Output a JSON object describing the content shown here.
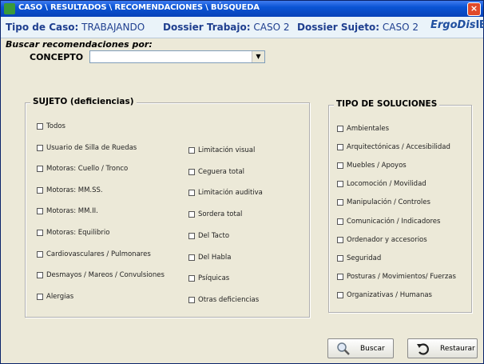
{
  "window": {
    "title": "CASO \\ RESULTADOS \\ RECOMENDACIONES \\ BÚSQUEDA",
    "close_label": "×"
  },
  "info": {
    "tipo_label": "Tipo de Caso:",
    "tipo_value": "TRABAJANDO",
    "dossier_trabajo_label": "Dossier Trabajo:",
    "dossier_trabajo_value": "CASO 2",
    "dossier_sujeto_label": "Dossier Sujeto:",
    "dossier_sujeto_value": "CASO 2",
    "logo_ergo": "ErgoDis",
    "logo_ibv": "IBV"
  },
  "search": {
    "heading": "Buscar recomendaciones por:",
    "concepto_label": "CONCEPTO",
    "concepto_value": ""
  },
  "sujeto": {
    "title": "SUJETO (deficiencias)",
    "col1": [
      "Todos",
      "Usuario de Silla de Ruedas",
      "Motoras: Cuello / Tronco",
      "Motoras: MM.SS.",
      "Motoras: MM.II.",
      "Motoras: Equilibrio",
      "Cardiovasculares / Pulmonares",
      "Desmayos / Mareos / Convulsiones",
      "Alergias"
    ],
    "col2": [
      "Limitación visual",
      "Ceguera total",
      "Limitación auditiva",
      "Sordera total",
      "Del Tacto",
      "Del Habla",
      "Psíquicas",
      "Otras deficiencias"
    ]
  },
  "soluciones": {
    "title": "TIPO DE SOLUCIONES",
    "items": [
      "Ambientales",
      "Arquitectónicas / Accesibilidad",
      "Muebles / Apoyos",
      "Locomoción / Movilidad",
      "Manipulación / Controles",
      "Comunicación / Indicadores",
      "Ordenador y accesorios",
      "Seguridad",
      "Posturas / Movimientos/ Fuerzas",
      "Organizativas / Humanas"
    ]
  },
  "buttons": {
    "buscar": "Buscar",
    "restaurar": "Restaurar"
  }
}
